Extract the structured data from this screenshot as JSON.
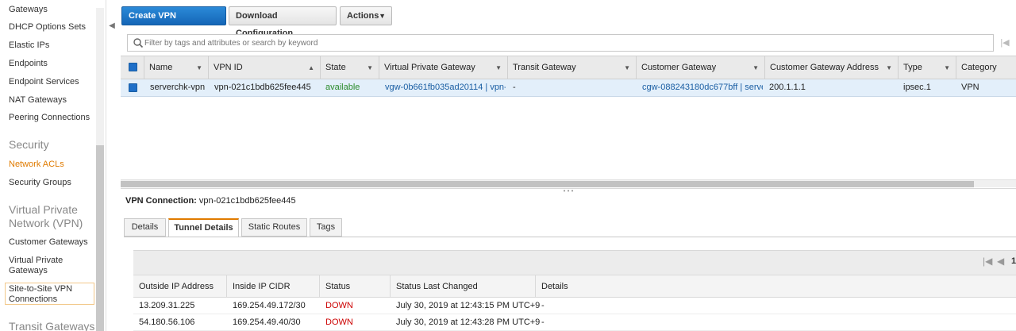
{
  "sidebar": {
    "items": [
      {
        "label": "Gateways"
      },
      {
        "label": "DHCP Options Sets"
      },
      {
        "label": "Elastic IPs"
      },
      {
        "label": "Endpoints"
      },
      {
        "label": "Endpoint Services"
      },
      {
        "label": "NAT Gateways"
      },
      {
        "label": "Peering Connections"
      }
    ],
    "security_heading": "Security",
    "security_items": [
      {
        "label": "Network ACLs"
      },
      {
        "label": "Security Groups"
      }
    ],
    "vpn_heading": "Virtual Private Network (VPN)",
    "vpn_items": [
      {
        "label": "Customer Gateways"
      },
      {
        "label": "Virtual Private Gateways"
      },
      {
        "label": "Site-to-Site VPN Connections"
      }
    ],
    "transit_heading": "Transit Gateways"
  },
  "toolbar": {
    "create_label": "Create VPN Connection",
    "download_label": "Download Configuration",
    "actions_label": "Actions"
  },
  "filter": {
    "placeholder": "Filter by tags and attributes or search by keyword"
  },
  "table": {
    "columns": [
      "Name",
      "VPN ID",
      "State",
      "Virtual Private Gateway",
      "Transit Gateway",
      "Customer Gateway",
      "Customer Gateway Address",
      "Type",
      "Category"
    ],
    "row": {
      "name": "serverchk-vpn",
      "vpn_id": "vpn-021c1bdb625fee445",
      "state": "available",
      "vgw": "vgw-0b661fb035ad20114 | vpn-…",
      "transit": "-",
      "cgw": "cgw-088243180dc677bff | serve…",
      "cgw_address": "200.1.1.1",
      "type": "ipsec.1",
      "category": "VPN"
    }
  },
  "detail": {
    "title_label": "VPN Connection:",
    "title_value": "vpn-021c1bdb625fee445",
    "tabs": [
      {
        "label": "Details"
      },
      {
        "label": "Tunnel Details"
      },
      {
        "label": "Static Routes"
      },
      {
        "label": "Tags"
      }
    ],
    "pager_page": "1",
    "columns": [
      "Outside IP Address",
      "Inside IP CIDR",
      "Status",
      "Status Last Changed",
      "Details"
    ],
    "rows": [
      {
        "outside_ip": "13.209.31.225",
        "inside_cidr": "169.254.49.172/30",
        "status": "DOWN",
        "changed": "July 30, 2019 at 12:43:15 PM UTC+9",
        "details": "-"
      },
      {
        "outside_ip": "54.180.56.106",
        "inside_cidr": "169.254.49.40/30",
        "status": "DOWN",
        "changed": "July 30, 2019 at 12:43:28 PM UTC+9",
        "details": "-"
      }
    ]
  },
  "colors": {
    "accent": "#e07b00",
    "primary_button": "#1f6fc8",
    "link": "#1a5ea3",
    "available": "#2a8a2a",
    "down": "#cc0000"
  }
}
